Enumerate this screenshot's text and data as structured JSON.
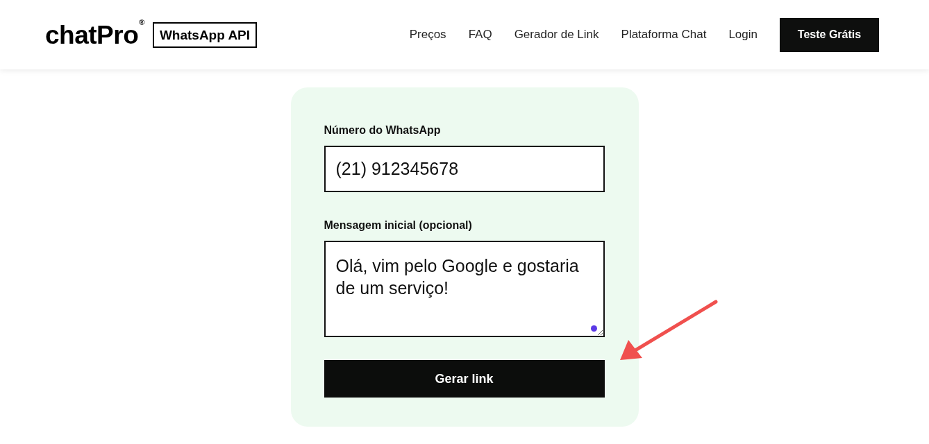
{
  "header": {
    "logo": "chatPro",
    "logo_mark": "®",
    "badge": "WhatsApp API",
    "nav": [
      "Preços",
      "FAQ",
      "Gerador de Link",
      "Plataforma Chat",
      "Login"
    ],
    "cta": "Teste Grátis"
  },
  "form": {
    "phone": {
      "label": "Número do WhatsApp",
      "value": "(21) 912345678"
    },
    "message": {
      "label": "Mensagem inicial (opcional)",
      "value": "Olá, vim pelo Google e gostaria de um serviço!"
    },
    "submit": "Gerar link"
  }
}
